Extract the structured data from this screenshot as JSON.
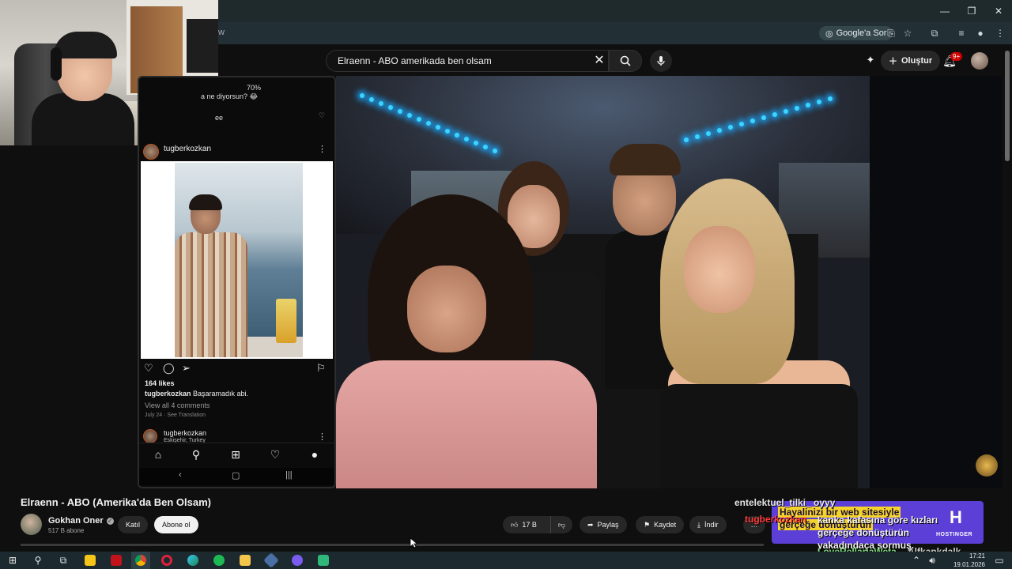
{
  "browser": {
    "address_fragment": "w",
    "google_sor_label": "Google'a Sor",
    "window_controls": [
      "—",
      "❐",
      "✕"
    ]
  },
  "youtube_header": {
    "search_query": "Elraenn - ABO amerikada ben olsam",
    "create_label": "Oluştur",
    "notification_badge": "9+"
  },
  "phone": {
    "status_text": "70%",
    "message_preview_1": "a ne diyorsun? 😂",
    "message_preview_2": "ee",
    "post_username": "tugberkozkan",
    "likes": "164 likes",
    "caption_user": "tugberkozkan",
    "caption_text": " Başaramadık abi.",
    "comments_link": "View all 4 comments",
    "post_date": "July 24 · See Translation",
    "post2_username": "tugberkozkan",
    "post2_location": "Eskişehir, Turkey"
  },
  "video_info": {
    "title": "Elraenn - ABO (Amerika'da Ben Olsam)",
    "channel_name": "Gokhan Oner",
    "subscribers": "517 B abone",
    "join_label": "Katıl",
    "subscribe_label": "Abone ol",
    "likes": "17 B",
    "share_label": "Paylaş",
    "save_label": "Kaydet",
    "download_label": "İndir",
    "more_label": "…"
  },
  "chat": {
    "line1": "entelektuel_tilki_ oyyy",
    "user2": "tugberkozkan",
    "msg2": "kanka kafasına göre kızları gerçeğe dönüştürün yakadındaça sormuş.",
    "user3": "LoveRellariaWeta",
    "user4": "Alfkapkdalk"
  },
  "ad": {
    "text_line1": "Hayalinizi bir web sitesiyle",
    "text_line2": "gerçeğe dönüştürün",
    "brand": "HOSTINGER",
    "logo": "H"
  },
  "taskbar": {
    "time": "17:21",
    "date": "19.01.2026"
  },
  "colors": {
    "youtube_bg": "#0f0f0f",
    "pill_bg": "#272727",
    "ad_purple": "#5b3fd6",
    "ad_yellow": "#f5d32a",
    "led_blue": "#3bd6ff",
    "chat_red": "#ff3b3b",
    "chat_green": "#7ee07e"
  }
}
